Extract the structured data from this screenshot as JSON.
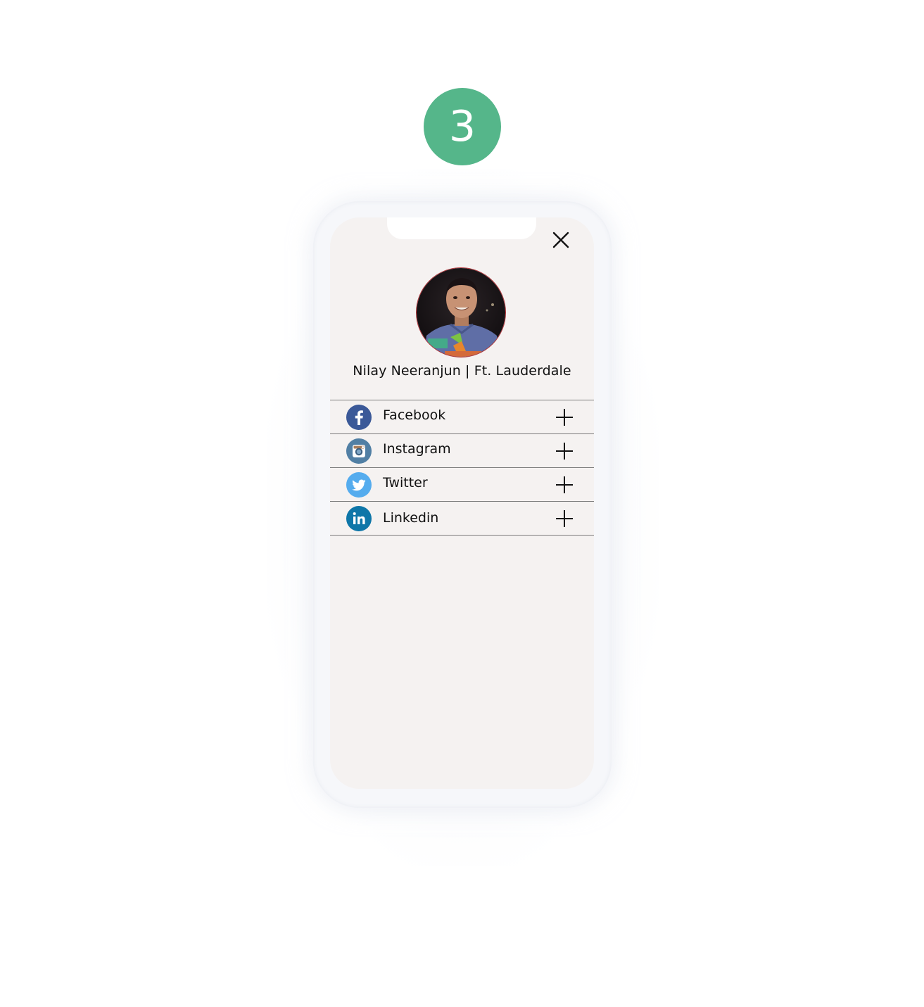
{
  "step": {
    "number": "3",
    "color": "#55b68a"
  },
  "screen": {
    "background": "#f5f2f1",
    "close_icon": "close-icon"
  },
  "profile": {
    "name_line": "Nilay Neeranjun | Ft. Lauderdale",
    "avatar": "profile-photo"
  },
  "social_accounts": [
    {
      "label": "Facebook",
      "icon": "facebook-icon",
      "brand_color": "#3b5998",
      "action_icon": "plus-icon"
    },
    {
      "label": "Instagram",
      "icon": "instagram-icon",
      "brand_color": "#517fa4",
      "action_icon": "plus-icon"
    },
    {
      "label": "Twitter",
      "icon": "twitter-icon",
      "brand_color": "#55acee",
      "action_icon": "plus-icon"
    },
    {
      "label": "Linkedin",
      "icon": "linkedin-icon",
      "brand_color": "#0e76a8",
      "action_icon": "plus-icon"
    }
  ]
}
